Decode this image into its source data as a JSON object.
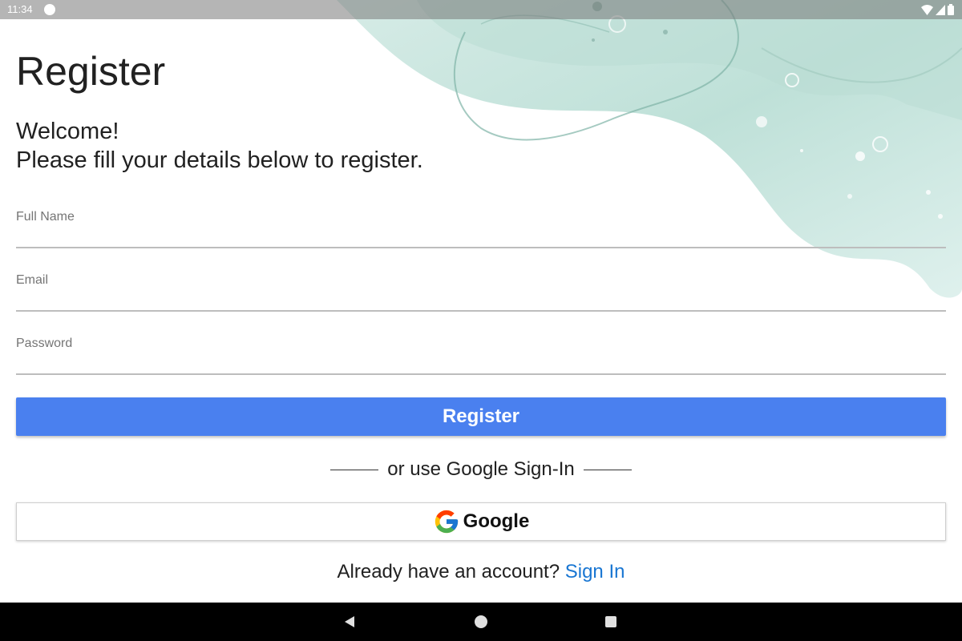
{
  "status_bar": {
    "time": "11:34"
  },
  "page": {
    "title": "Register",
    "welcome": "Welcome!",
    "instructions": "Please fill your details below to register."
  },
  "form": {
    "full_name_label": "Full Name",
    "email_label": "Email",
    "password_label": "Password",
    "register_button": "Register"
  },
  "divider_text": "or use Google Sign-In",
  "google_button": {
    "label": "Google",
    "icon": "google-g-icon"
  },
  "footer": {
    "prompt": "Already have an account?",
    "signin_link": "Sign In"
  },
  "colors": {
    "primary": "#4a80ef",
    "link": "#1976d2",
    "watercolor": "#a9d3c8"
  }
}
